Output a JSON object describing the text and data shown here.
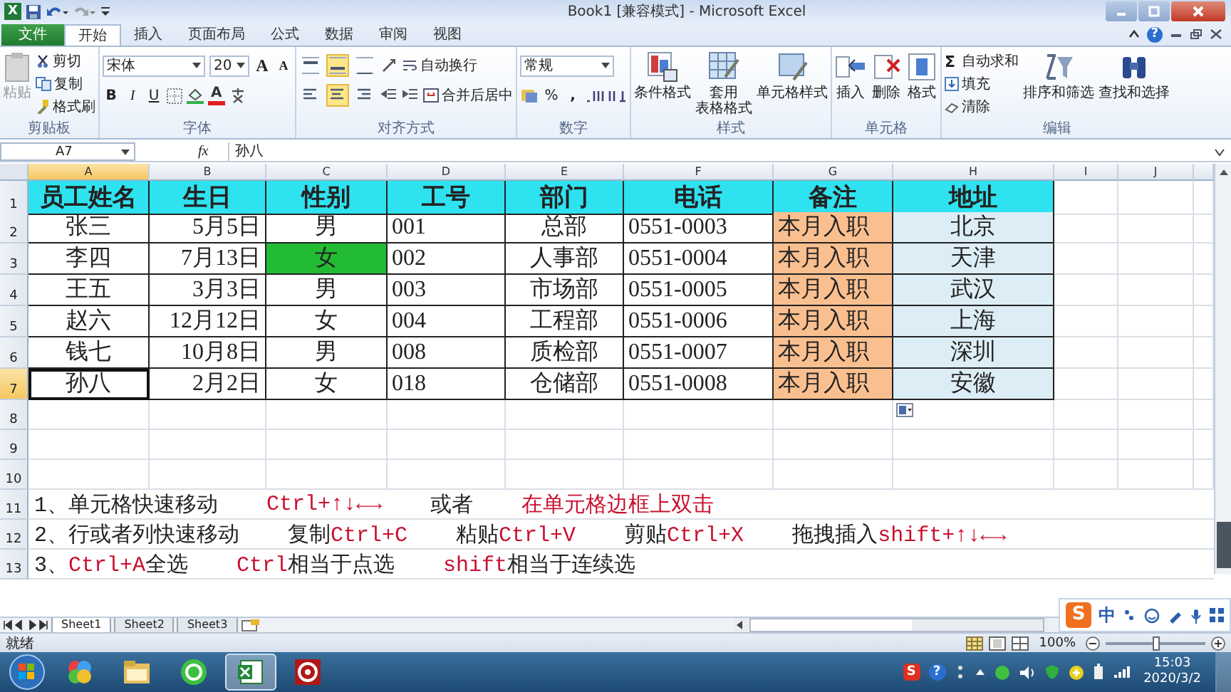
{
  "window": {
    "app_logo": "X",
    "title": "Book1  [兼容模式] - Microsoft Excel",
    "help": "?"
  },
  "tabs": [
    {
      "label": "文件",
      "kind": "file",
      "selected": false
    },
    {
      "label": "开始",
      "kind": "tab",
      "selected": true
    },
    {
      "label": "插入",
      "kind": "tab",
      "selected": false
    },
    {
      "label": "页面布局",
      "kind": "tab",
      "selected": false
    },
    {
      "label": "公式",
      "kind": "tab",
      "selected": false
    },
    {
      "label": "数据",
      "kind": "tab",
      "selected": false
    },
    {
      "label": "审阅",
      "kind": "tab",
      "selected": false
    },
    {
      "label": "视图",
      "kind": "tab",
      "selected": false
    }
  ],
  "ribbon": {
    "clipboard": {
      "label": "剪贴板",
      "paste": "粘贴",
      "cut": "剪切",
      "copy": "复制",
      "format_painter": "格式刷"
    },
    "font": {
      "label": "字体",
      "name": "宋体",
      "size": "20",
      "grow": "A",
      "shrink": "A",
      "bold": "B",
      "italic": "I",
      "underline": "U",
      "font_color_label": "A"
    },
    "alignment": {
      "label": "对齐方式",
      "wrap": "自动换行",
      "merge": "合并后居中",
      "vertical_align": [
        {
          "selected": false
        },
        {
          "selected": true
        },
        {
          "selected": false
        }
      ],
      "horizontal_align": [
        {
          "selected": false
        },
        {
          "selected": true
        },
        {
          "selected": false
        }
      ]
    },
    "number": {
      "label": "数字",
      "format": "常规",
      "percent": "%",
      "comma": ","
    },
    "styles": {
      "label": "样式",
      "conditional": "条件格式",
      "table_line1": "套用",
      "table_line2": "表格格式",
      "cell_styles": "单元格样式"
    },
    "cells": {
      "label": "单元格",
      "insert": "插入",
      "delete": "删除",
      "format": "格式"
    },
    "editing": {
      "label": "编辑",
      "sigma": "Σ",
      "autosum": "自动求和",
      "fill": "填充",
      "clear": "清除",
      "sort": "排序和筛选",
      "find": "查找和选择"
    }
  },
  "formula_bar": {
    "name_box": "A7",
    "function_label": "fx",
    "value": "孙八"
  },
  "sheet": {
    "columns": [
      {
        "label": "A",
        "selected": true
      },
      {
        "label": "B",
        "selected": false
      },
      {
        "label": "C",
        "selected": false
      },
      {
        "label": "D",
        "selected": false
      },
      {
        "label": "E",
        "selected": false
      },
      {
        "label": "F",
        "selected": false
      },
      {
        "label": "G",
        "selected": false
      },
      {
        "label": "H",
        "selected": false
      },
      {
        "label": "I",
        "selected": false
      },
      {
        "label": "J",
        "selected": false
      }
    ],
    "rows": [
      {
        "number": "1",
        "kind": "data",
        "selected": false,
        "cells": [
          {
            "text": "员工姓名",
            "color": "#2fe2f0",
            "selected": false
          },
          {
            "text": "生日",
            "color": "#2fe2f0",
            "selected": false
          },
          {
            "text": "性别",
            "color": "#2fe2f0",
            "selected": false
          },
          {
            "text": "工号",
            "color": "#2fe2f0",
            "selected": false
          },
          {
            "text": "部门",
            "color": "#2fe2f0",
            "selected": false
          },
          {
            "text": "电话",
            "color": "#2fe2f0",
            "selected": false
          },
          {
            "text": "备注",
            "color": "#2fe2f0",
            "selected": false
          },
          {
            "text": "地址",
            "color": "#2fe2f0",
            "selected": false
          }
        ]
      },
      {
        "number": "2",
        "kind": "data",
        "selected": false,
        "cells": [
          {
            "text": "张三",
            "selected": false
          },
          {
            "text": "5月5日",
            "selected": false
          },
          {
            "text": "男",
            "selected": false
          },
          {
            "text": "001",
            "selected": false
          },
          {
            "text": "总部",
            "selected": false
          },
          {
            "text": "0551-0003",
            "selected": false
          },
          {
            "text": "本月入职",
            "color": "#fabf8f",
            "selected": false
          },
          {
            "text": "北京",
            "color": "#dcedf5",
            "selected": false
          }
        ]
      },
      {
        "number": "3",
        "kind": "data",
        "selected": false,
        "cells": [
          {
            "text": "李四",
            "selected": false
          },
          {
            "text": "7月13日",
            "selected": false
          },
          {
            "text": "女",
            "color": "#22bb33",
            "selected": false
          },
          {
            "text": "002",
            "selected": false
          },
          {
            "text": "人事部",
            "selected": false
          },
          {
            "text": "0551-0004",
            "selected": false
          },
          {
            "text": "本月入职",
            "color": "#fabf8f",
            "selected": false
          },
          {
            "text": "天津",
            "color": "#dcedf5",
            "selected": false
          }
        ]
      },
      {
        "number": "4",
        "kind": "data",
        "selected": false,
        "cells": [
          {
            "text": "王五",
            "selected": false
          },
          {
            "text": "3月3日",
            "selected": false
          },
          {
            "text": "男",
            "selected": false
          },
          {
            "text": "003",
            "selected": false
          },
          {
            "text": "市场部",
            "selected": false
          },
          {
            "text": "0551-0005",
            "selected": false
          },
          {
            "text": "本月入职",
            "color": "#fabf8f",
            "selected": false
          },
          {
            "text": "武汉",
            "color": "#dcedf5",
            "selected": false
          }
        ]
      },
      {
        "number": "5",
        "kind": "data",
        "selected": false,
        "cells": [
          {
            "text": "赵六",
            "selected": false
          },
          {
            "text": "12月12日",
            "selected": false
          },
          {
            "text": "女",
            "selected": false
          },
          {
            "text": "004",
            "selected": false
          },
          {
            "text": "工程部",
            "selected": false
          },
          {
            "text": "0551-0006",
            "selected": false
          },
          {
            "text": "本月入职",
            "color": "#fabf8f",
            "selected": false
          },
          {
            "text": "上海",
            "color": "#dcedf5",
            "selected": false
          }
        ]
      },
      {
        "number": "6",
        "kind": "data",
        "selected": false,
        "cells": [
          {
            "text": "钱七",
            "selected": false
          },
          {
            "text": "10月8日",
            "selected": false
          },
          {
            "text": "男",
            "selected": false
          },
          {
            "text": "008",
            "selected": false
          },
          {
            "text": "质检部",
            "selected": false
          },
          {
            "text": "0551-0007",
            "selected": false
          },
          {
            "text": "本月入职",
            "color": "#fabf8f",
            "selected": false
          },
          {
            "text": "深圳",
            "color": "#dcedf5",
            "selected": false
          }
        ]
      },
      {
        "number": "7",
        "kind": "data",
        "selected": true,
        "cells": [
          {
            "text": "孙八",
            "selected": true
          },
          {
            "text": "2月2日",
            "selected": false
          },
          {
            "text": "女",
            "selected": false
          },
          {
            "text": "018",
            "selected": false
          },
          {
            "text": "仓储部",
            "selected": false
          },
          {
            "text": "0551-0008",
            "selected": false
          },
          {
            "text": "本月入职",
            "color": "#fabf8f",
            "selected": false
          },
          {
            "text": "安徽",
            "color": "#dcedf5",
            "selected": false
          }
        ]
      },
      {
        "number": "8",
        "kind": "empty",
        "selected": false
      },
      {
        "number": "9",
        "kind": "empty",
        "selected": false
      },
      {
        "number": "10",
        "kind": "empty",
        "selected": false
      },
      {
        "number": "11",
        "kind": "note",
        "selected": false,
        "note": [
          {
            "parts": [
              {
                "text": "1、单元格快速移动",
                "kind": "plain"
              }
            ]
          },
          {
            "parts": [
              {
                "text": "Ctrl+↑↓←→",
                "kind": "key"
              }
            ]
          },
          {
            "parts": [
              {
                "text": "或者",
                "kind": "plain"
              }
            ]
          },
          {
            "parts": [
              {
                "text": "在单元格边框上双击",
                "kind": "key"
              }
            ]
          }
        ]
      },
      {
        "number": "12",
        "kind": "note",
        "selected": false,
        "note": [
          {
            "parts": [
              {
                "text": "2、行或者列快速移动",
                "kind": "plain"
              }
            ]
          },
          {
            "parts": [
              {
                "text": "复制",
                "kind": "plain"
              },
              {
                "text": "Ctrl+C",
                "kind": "key"
              }
            ]
          },
          {
            "parts": [
              {
                "text": "粘贴",
                "kind": "plain"
              },
              {
                "text": "Ctrl+V",
                "kind": "key"
              }
            ]
          },
          {
            "parts": [
              {
                "text": "剪贴",
                "kind": "plain"
              },
              {
                "text": "Ctrl+X",
                "kind": "key"
              }
            ]
          },
          {
            "parts": [
              {
                "text": "拖拽插入",
                "kind": "plain"
              },
              {
                "text": "shift+↑↓←→",
                "kind": "key"
              }
            ]
          }
        ]
      },
      {
        "number": "13",
        "kind": "note",
        "selected": false,
        "note": [
          {
            "parts": [
              {
                "text": "3、",
                "kind": "plain"
              },
              {
                "text": "Ctrl+A",
                "kind": "key"
              },
              {
                "text": "全选",
                "kind": "plain"
              }
            ]
          },
          {
            "parts": [
              {
                "text": "Ctrl",
                "kind": "key"
              },
              {
                "text": "相当于点选",
                "kind": "plain"
              }
            ]
          },
          {
            "parts": [
              {
                "text": "shift",
                "kind": "key"
              },
              {
                "text": "相当于连续选",
                "kind": "plain"
              }
            ]
          }
        ]
      }
    ],
    "paste_options": true
  },
  "sheet_tabs": [
    {
      "label": "Sheet1",
      "selected": true
    },
    {
      "label": "Sheet2",
      "selected": false
    },
    {
      "label": "Sheet3",
      "selected": false
    }
  ],
  "status_bar": {
    "status": "就绪",
    "zoom": "100%",
    "zoom_slider": {
      "level": 0.5
    }
  },
  "ime": {
    "logo": "S",
    "mode": "中"
  },
  "taskbar": {
    "tray_logo": "S",
    "help": "?",
    "time": "15:03",
    "date": "2020/3/2"
  }
}
